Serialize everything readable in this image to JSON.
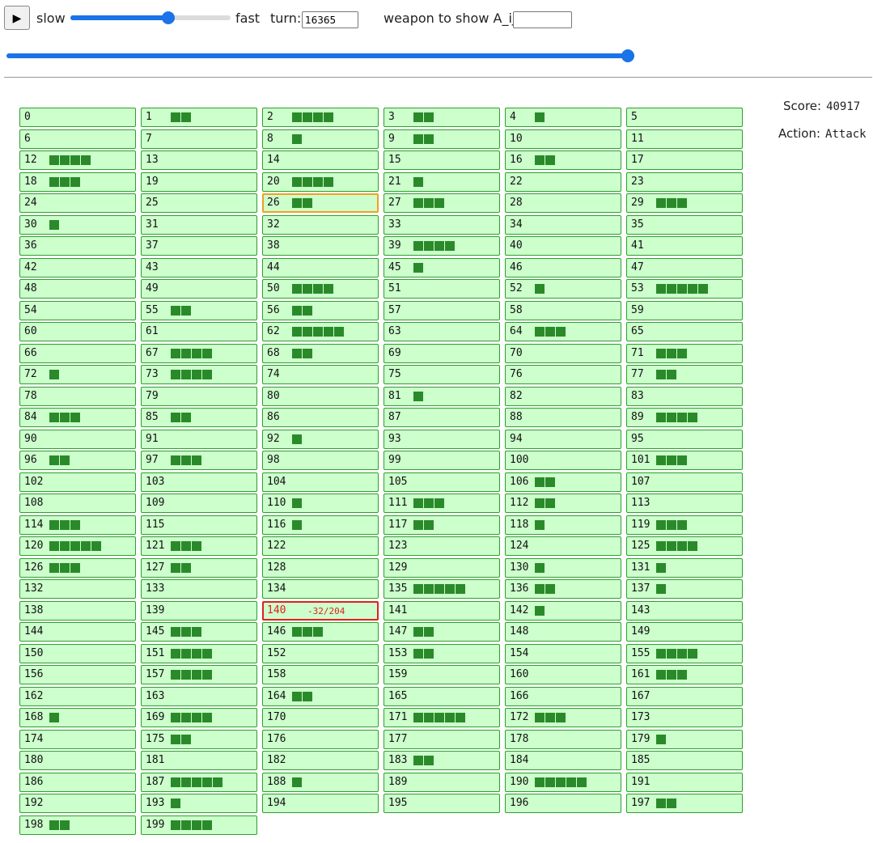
{
  "controls": {
    "play_icon": "play-icon",
    "play_glyph": "▶",
    "slow_label": "slow",
    "fast_label": "fast",
    "turn_label": "turn:",
    "turn_value": "16365",
    "weapon_label": "weapon to show A_ij:",
    "weapon_value": "",
    "speed_level": 0.62,
    "turn_progress": 1.0
  },
  "info": {
    "score_label": "Score:",
    "score_value": "40917",
    "action_label": "Action:",
    "action_value": "Attack"
  },
  "colors": {
    "cell_bg": "#ccffcc",
    "cell_border": "#2e9e2e",
    "bar": "#2a8a2a",
    "selected_orange": "#f0a020",
    "selected_red": "#e02020",
    "slider": "#1a73e8"
  },
  "grid": {
    "columns": 6,
    "highlight_orange": 26,
    "highlight_red": 140,
    "red_cell_text": "-32/204",
    "cells": [
      {
        "id": "0",
        "bars": 0
      },
      {
        "id": "1",
        "bars": 2
      },
      {
        "id": "2",
        "bars": 4
      },
      {
        "id": "3",
        "bars": 2
      },
      {
        "id": "4",
        "bars": 1
      },
      {
        "id": "5",
        "bars": 0
      },
      {
        "id": "6",
        "bars": 0
      },
      {
        "id": "7",
        "bars": 0
      },
      {
        "id": "8",
        "bars": 1
      },
      {
        "id": "9",
        "bars": 2
      },
      {
        "id": "10",
        "bars": 0
      },
      {
        "id": "11",
        "bars": 0
      },
      {
        "id": "12",
        "bars": 4
      },
      {
        "id": "13",
        "bars": 0
      },
      {
        "id": "14",
        "bars": 0
      },
      {
        "id": "15",
        "bars": 0
      },
      {
        "id": "16",
        "bars": 2
      },
      {
        "id": "17",
        "bars": 0
      },
      {
        "id": "18",
        "bars": 3
      },
      {
        "id": "19",
        "bars": 0
      },
      {
        "id": "20",
        "bars": 4
      },
      {
        "id": "21",
        "bars": 1
      },
      {
        "id": "22",
        "bars": 0
      },
      {
        "id": "23",
        "bars": 0
      },
      {
        "id": "24",
        "bars": 0
      },
      {
        "id": "25",
        "bars": 0
      },
      {
        "id": "26",
        "bars": 2
      },
      {
        "id": "27",
        "bars": 3
      },
      {
        "id": "28",
        "bars": 0
      },
      {
        "id": "29",
        "bars": 3
      },
      {
        "id": "30",
        "bars": 1
      },
      {
        "id": "31",
        "bars": 0
      },
      {
        "id": "32",
        "bars": 0
      },
      {
        "id": "33",
        "bars": 0
      },
      {
        "id": "34",
        "bars": 0
      },
      {
        "id": "35",
        "bars": 0
      },
      {
        "id": "36",
        "bars": 0
      },
      {
        "id": "37",
        "bars": 0
      },
      {
        "id": "38",
        "bars": 0
      },
      {
        "id": "39",
        "bars": 4
      },
      {
        "id": "40",
        "bars": 0
      },
      {
        "id": "41",
        "bars": 0
      },
      {
        "id": "42",
        "bars": 0
      },
      {
        "id": "43",
        "bars": 0
      },
      {
        "id": "44",
        "bars": 0
      },
      {
        "id": "45",
        "bars": 1
      },
      {
        "id": "46",
        "bars": 0
      },
      {
        "id": "47",
        "bars": 0
      },
      {
        "id": "48",
        "bars": 0
      },
      {
        "id": "49",
        "bars": 0
      },
      {
        "id": "50",
        "bars": 4
      },
      {
        "id": "51",
        "bars": 0
      },
      {
        "id": "52",
        "bars": 1
      },
      {
        "id": "53",
        "bars": 5
      },
      {
        "id": "54",
        "bars": 0
      },
      {
        "id": "55",
        "bars": 2
      },
      {
        "id": "56",
        "bars": 2
      },
      {
        "id": "57",
        "bars": 0
      },
      {
        "id": "58",
        "bars": 0
      },
      {
        "id": "59",
        "bars": 0
      },
      {
        "id": "60",
        "bars": 0
      },
      {
        "id": "61",
        "bars": 0
      },
      {
        "id": "62",
        "bars": 5
      },
      {
        "id": "63",
        "bars": 0
      },
      {
        "id": "64",
        "bars": 3
      },
      {
        "id": "65",
        "bars": 0
      },
      {
        "id": "66",
        "bars": 0
      },
      {
        "id": "67",
        "bars": 4
      },
      {
        "id": "68",
        "bars": 2
      },
      {
        "id": "69",
        "bars": 0
      },
      {
        "id": "70",
        "bars": 0
      },
      {
        "id": "71",
        "bars": 3
      },
      {
        "id": "72",
        "bars": 1
      },
      {
        "id": "73",
        "bars": 4
      },
      {
        "id": "74",
        "bars": 0
      },
      {
        "id": "75",
        "bars": 0
      },
      {
        "id": "76",
        "bars": 0
      },
      {
        "id": "77",
        "bars": 2
      },
      {
        "id": "78",
        "bars": 0
      },
      {
        "id": "79",
        "bars": 0
      },
      {
        "id": "80",
        "bars": 0
      },
      {
        "id": "81",
        "bars": 1
      },
      {
        "id": "82",
        "bars": 0
      },
      {
        "id": "83",
        "bars": 0
      },
      {
        "id": "84",
        "bars": 3
      },
      {
        "id": "85",
        "bars": 2
      },
      {
        "id": "86",
        "bars": 0
      },
      {
        "id": "87",
        "bars": 0
      },
      {
        "id": "88",
        "bars": 0
      },
      {
        "id": "89",
        "bars": 4
      },
      {
        "id": "90",
        "bars": 0
      },
      {
        "id": "91",
        "bars": 0
      },
      {
        "id": "92",
        "bars": 1
      },
      {
        "id": "93",
        "bars": 0
      },
      {
        "id": "94",
        "bars": 0
      },
      {
        "id": "95",
        "bars": 0
      },
      {
        "id": "96",
        "bars": 2
      },
      {
        "id": "97",
        "bars": 3
      },
      {
        "id": "98",
        "bars": 0
      },
      {
        "id": "99",
        "bars": 0
      },
      {
        "id": "100",
        "bars": 0
      },
      {
        "id": "101",
        "bars": 3
      },
      {
        "id": "102",
        "bars": 0
      },
      {
        "id": "103",
        "bars": 0
      },
      {
        "id": "104",
        "bars": 0
      },
      {
        "id": "105",
        "bars": 0
      },
      {
        "id": "106",
        "bars": 2
      },
      {
        "id": "107",
        "bars": 0
      },
      {
        "id": "108",
        "bars": 0
      },
      {
        "id": "109",
        "bars": 0
      },
      {
        "id": "110",
        "bars": 1
      },
      {
        "id": "111",
        "bars": 3
      },
      {
        "id": "112",
        "bars": 2
      },
      {
        "id": "113",
        "bars": 0
      },
      {
        "id": "114",
        "bars": 3
      },
      {
        "id": "115",
        "bars": 0
      },
      {
        "id": "116",
        "bars": 1
      },
      {
        "id": "117",
        "bars": 2
      },
      {
        "id": "118",
        "bars": 1
      },
      {
        "id": "119",
        "bars": 3
      },
      {
        "id": "120",
        "bars": 5
      },
      {
        "id": "121",
        "bars": 3
      },
      {
        "id": "122",
        "bars": 0
      },
      {
        "id": "123",
        "bars": 0
      },
      {
        "id": "124",
        "bars": 0
      },
      {
        "id": "125",
        "bars": 4
      },
      {
        "id": "126",
        "bars": 3
      },
      {
        "id": "127",
        "bars": 2
      },
      {
        "id": "128",
        "bars": 0
      },
      {
        "id": "129",
        "bars": 0
      },
      {
        "id": "130",
        "bars": 1
      },
      {
        "id": "131",
        "bars": 1
      },
      {
        "id": "132",
        "bars": 0
      },
      {
        "id": "133",
        "bars": 0
      },
      {
        "id": "134",
        "bars": 0
      },
      {
        "id": "135",
        "bars": 5
      },
      {
        "id": "136",
        "bars": 2
      },
      {
        "id": "137",
        "bars": 1
      },
      {
        "id": "138",
        "bars": 0
      },
      {
        "id": "139",
        "bars": 0
      },
      {
        "id": "140",
        "bars": 0
      },
      {
        "id": "141",
        "bars": 0
      },
      {
        "id": "142",
        "bars": 1
      },
      {
        "id": "143",
        "bars": 0
      },
      {
        "id": "144",
        "bars": 0
      },
      {
        "id": "145",
        "bars": 3
      },
      {
        "id": "146",
        "bars": 3
      },
      {
        "id": "147",
        "bars": 2
      },
      {
        "id": "148",
        "bars": 0
      },
      {
        "id": "149",
        "bars": 0
      },
      {
        "id": "150",
        "bars": 0
      },
      {
        "id": "151",
        "bars": 4
      },
      {
        "id": "152",
        "bars": 0
      },
      {
        "id": "153",
        "bars": 2
      },
      {
        "id": "154",
        "bars": 0
      },
      {
        "id": "155",
        "bars": 4
      },
      {
        "id": "156",
        "bars": 0
      },
      {
        "id": "157",
        "bars": 4
      },
      {
        "id": "158",
        "bars": 0
      },
      {
        "id": "159",
        "bars": 0
      },
      {
        "id": "160",
        "bars": 0
      },
      {
        "id": "161",
        "bars": 3
      },
      {
        "id": "162",
        "bars": 0
      },
      {
        "id": "163",
        "bars": 0
      },
      {
        "id": "164",
        "bars": 2
      },
      {
        "id": "165",
        "bars": 0
      },
      {
        "id": "166",
        "bars": 0
      },
      {
        "id": "167",
        "bars": 0
      },
      {
        "id": "168",
        "bars": 1
      },
      {
        "id": "169",
        "bars": 4
      },
      {
        "id": "170",
        "bars": 0
      },
      {
        "id": "171",
        "bars": 5
      },
      {
        "id": "172",
        "bars": 3
      },
      {
        "id": "173",
        "bars": 0
      },
      {
        "id": "174",
        "bars": 0
      },
      {
        "id": "175",
        "bars": 2
      },
      {
        "id": "176",
        "bars": 0
      },
      {
        "id": "177",
        "bars": 0
      },
      {
        "id": "178",
        "bars": 0
      },
      {
        "id": "179",
        "bars": 1
      },
      {
        "id": "180",
        "bars": 0
      },
      {
        "id": "181",
        "bars": 0
      },
      {
        "id": "182",
        "bars": 0
      },
      {
        "id": "183",
        "bars": 2
      },
      {
        "id": "184",
        "bars": 0
      },
      {
        "id": "185",
        "bars": 0
      },
      {
        "id": "186",
        "bars": 0
      },
      {
        "id": "187",
        "bars": 5
      },
      {
        "id": "188",
        "bars": 1
      },
      {
        "id": "189",
        "bars": 0
      },
      {
        "id": "190",
        "bars": 5
      },
      {
        "id": "191",
        "bars": 0
      },
      {
        "id": "192",
        "bars": 0
      },
      {
        "id": "193",
        "bars": 1
      },
      {
        "id": "194",
        "bars": 0
      },
      {
        "id": "195",
        "bars": 0
      },
      {
        "id": "196",
        "bars": 0
      },
      {
        "id": "197",
        "bars": 2
      },
      {
        "id": "198",
        "bars": 2
      },
      {
        "id": "199",
        "bars": 4
      }
    ]
  }
}
